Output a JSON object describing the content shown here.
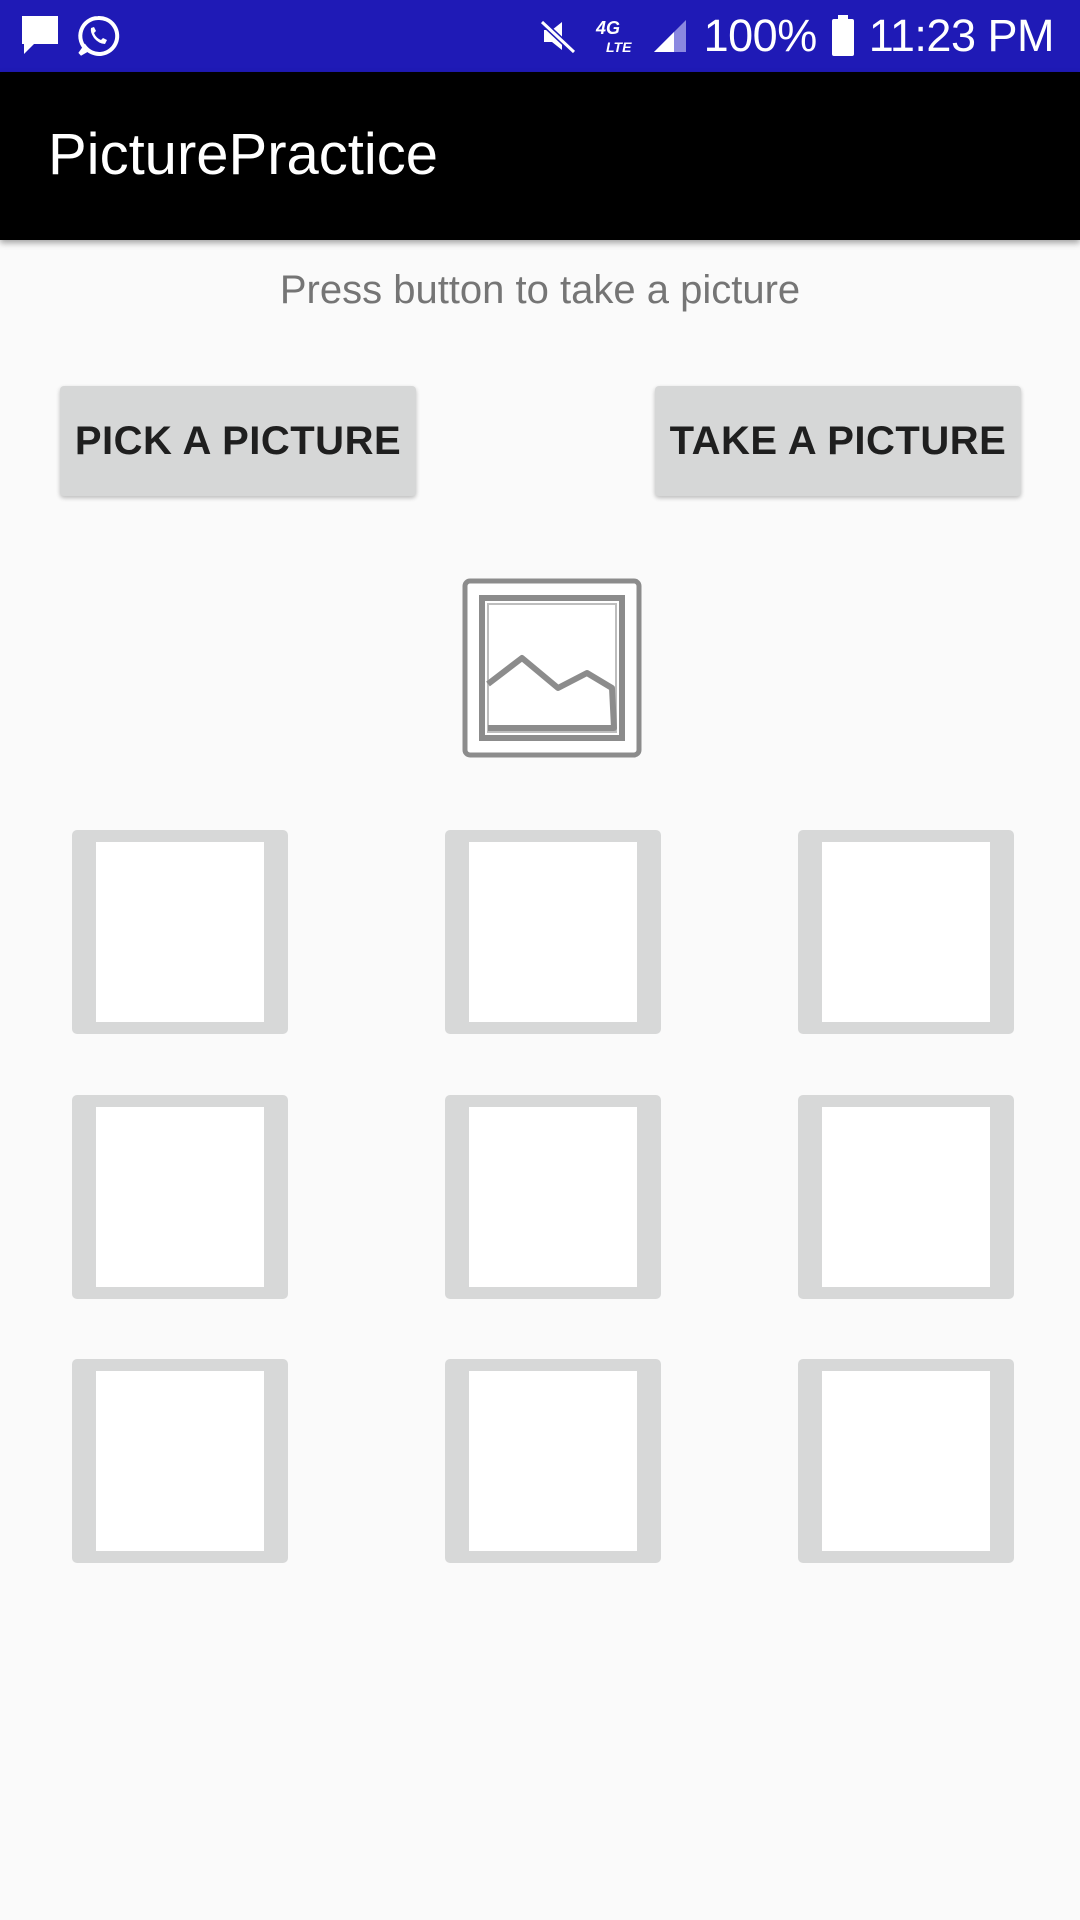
{
  "status_bar": {
    "icons_left": [
      "message-icon",
      "whatsapp-icon"
    ],
    "icons_right": [
      "mute-icon",
      "4g-lte-icon",
      "signal-icon"
    ],
    "network": "4G",
    "network_sub": "LTE",
    "battery": "100%",
    "time": "11:23 PM",
    "background": "#1f1ab6"
  },
  "app_bar": {
    "title": "PicturePractice",
    "background": "#000000"
  },
  "main": {
    "hint": "Press button to take a picture",
    "pick_button": "PICK A PICTURE",
    "take_button": "TAKE A PICTURE",
    "preview_icon": "image-placeholder-icon",
    "thumbnails": [
      {
        "row": 1,
        "col": 1
      },
      {
        "row": 1,
        "col": 2
      },
      {
        "row": 1,
        "col": 3
      },
      {
        "row": 2,
        "col": 1
      },
      {
        "row": 2,
        "col": 2
      },
      {
        "row": 2,
        "col": 3
      },
      {
        "row": 3,
        "col": 1
      },
      {
        "row": 3,
        "col": 2
      },
      {
        "row": 3,
        "col": 3
      }
    ]
  },
  "colors": {
    "button_bg": "#d6d7d7",
    "thumbnail_frame": "#d7d8d8",
    "hint_text": "#757575",
    "page_bg": "#fafafa"
  }
}
